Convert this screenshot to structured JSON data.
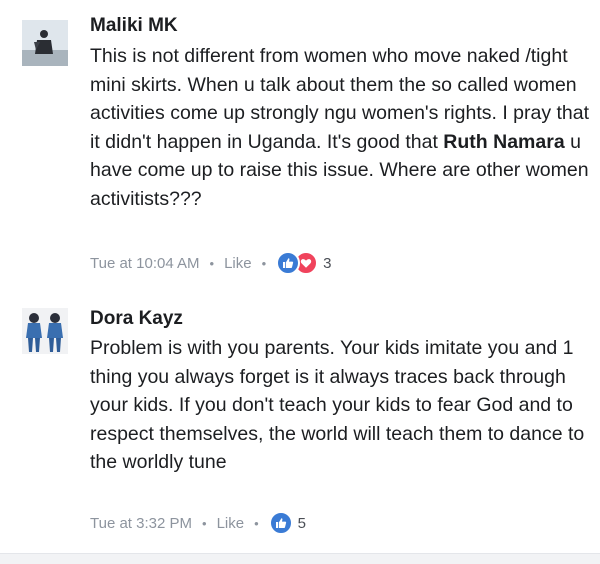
{
  "comments": [
    {
      "author": "Maliki MK",
      "text_before": "This is not different from women  who move naked /tight mini skirts. When u talk about them  the so called  women activities  come up strongly  ngu  women's rights.   I pray that it didn't happen in Uganda.  It's good that ",
      "mention": "Ruth Namara",
      "text_after": " u have come up to raise this issue. Where are other  women activitists???",
      "time": "Tue at 10:04 AM",
      "like_label": "Like",
      "reaction_count": "3",
      "reactions": [
        "like-icon",
        "love-icon"
      ]
    },
    {
      "author": "Dora Kayz",
      "text": "Problem is with you parents. Your kids imitate you and 1 thing you always forget is it always traces back through your kids. If you don't teach your kids to fear God and to respect themselves, the world will teach them to dance to the worldly tune",
      "time": "Tue at 3:32 PM",
      "like_label": "Like",
      "reaction_count": "5",
      "reactions": [
        "like-icon"
      ]
    }
  ],
  "separator": "•",
  "colors": {
    "like_blue": "#3a7bd5",
    "love_red": "#f0435c",
    "meta_gray": "#8d949e"
  }
}
